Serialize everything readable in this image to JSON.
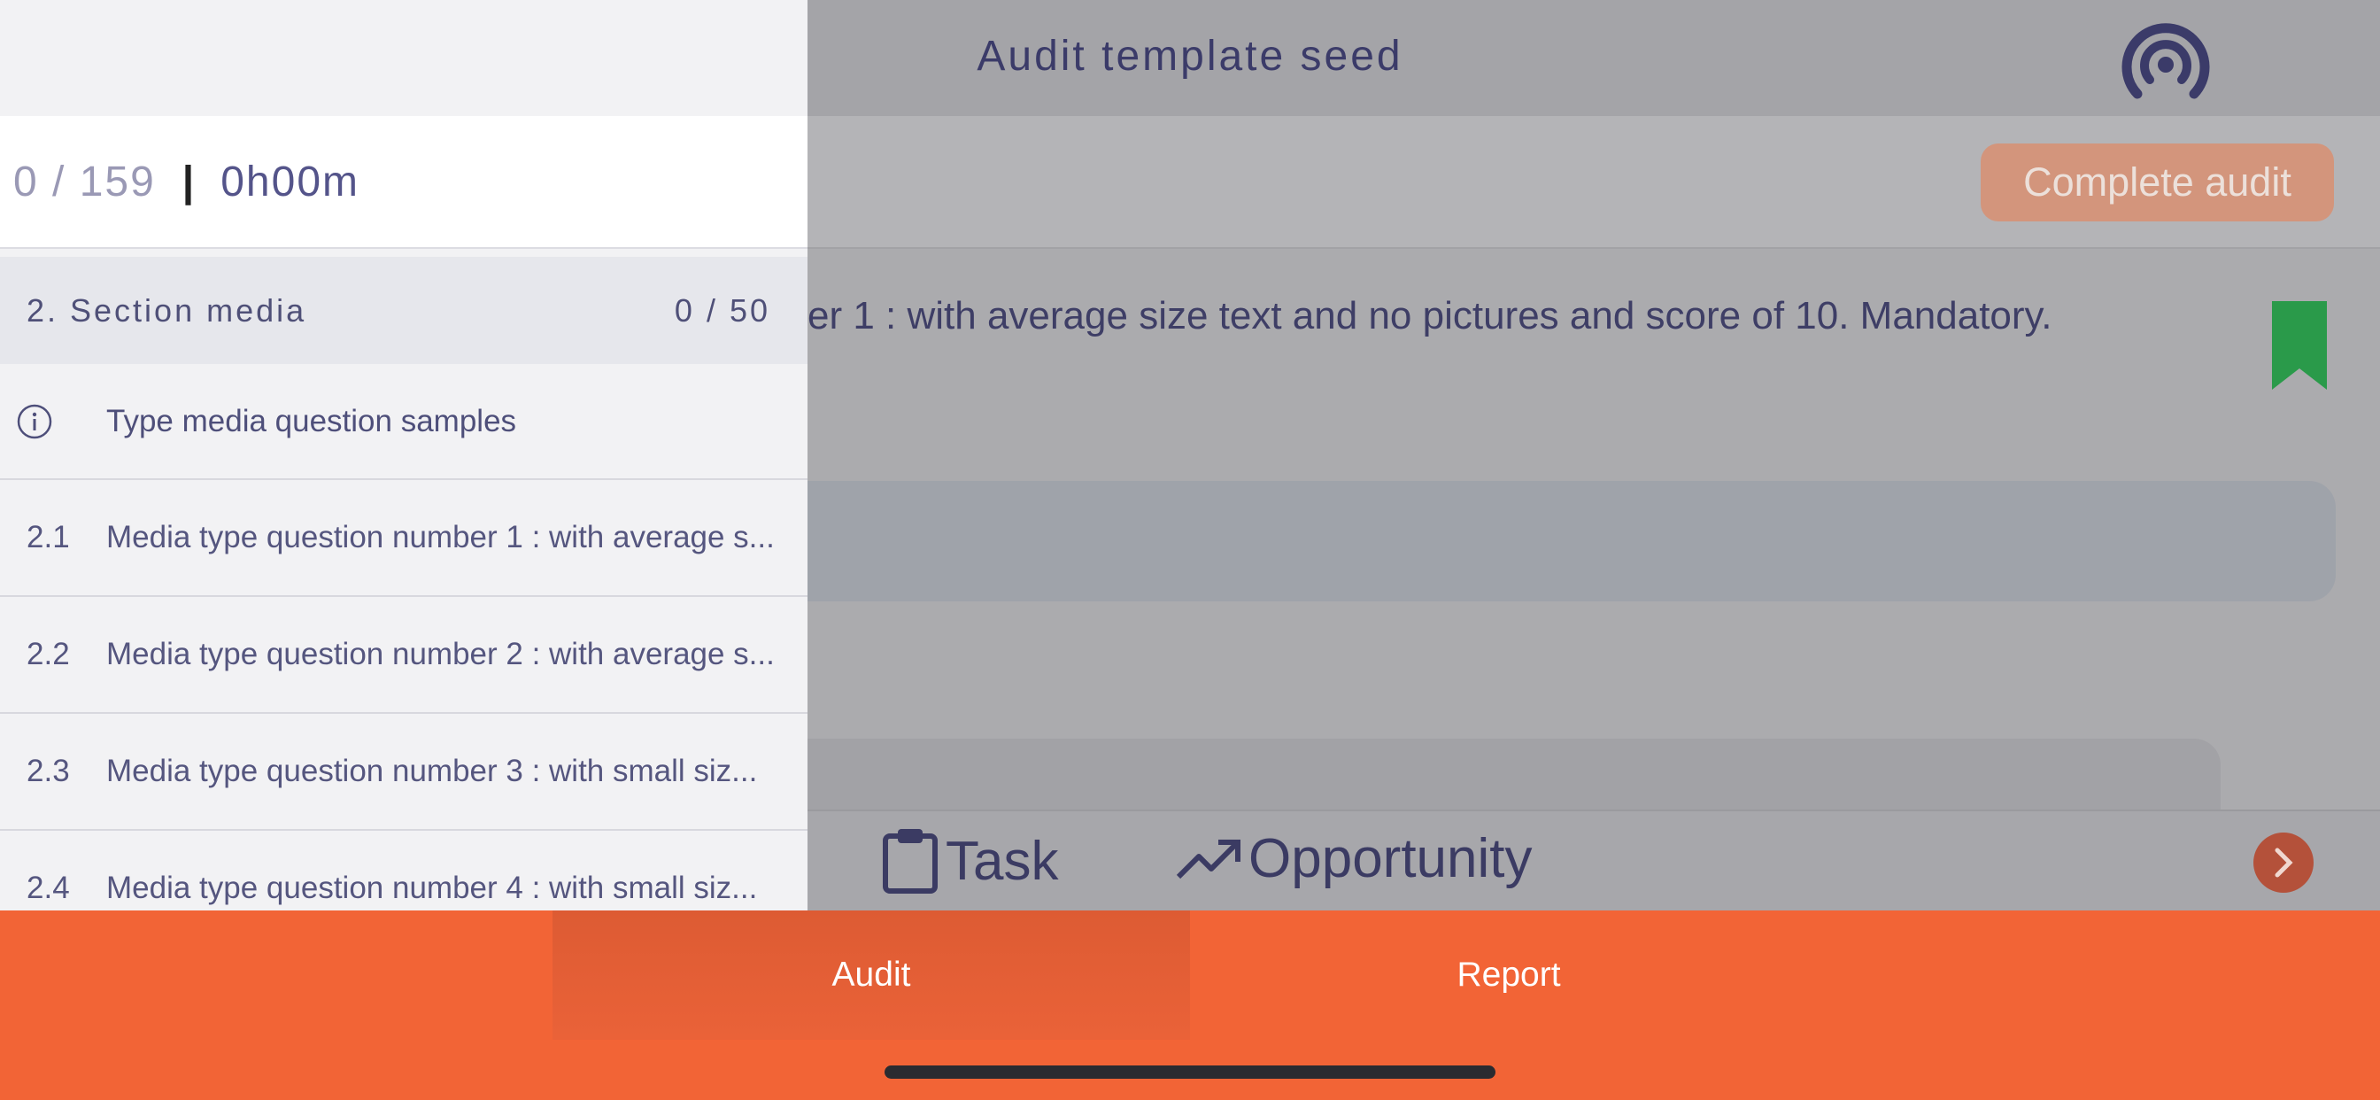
{
  "app": {
    "title": "Audit template seed",
    "broadcast_icon": "broadcast-icon"
  },
  "toolbar": {
    "complete_label": "Complete audit"
  },
  "question": {
    "text": "er 1 : with average size text and no pictures and score of 10. Mandatory."
  },
  "actions": {
    "task_label": "Task",
    "opportunity_label": "Opportunity"
  },
  "drawer": {
    "progress": {
      "count": "0 / 159",
      "separator": "|",
      "time": "0h00m"
    },
    "section": {
      "title": "2. Section media",
      "count": "0 / 50"
    },
    "info": {
      "text": "Type media question samples"
    },
    "questions": [
      {
        "num": "2.1",
        "text": "Media type question number 1 : with average s..."
      },
      {
        "num": "2.2",
        "text": "Media type question number 2 : with average s..."
      },
      {
        "num": "2.3",
        "text": "Media type question number 3 : with small siz..."
      },
      {
        "num": "2.4",
        "text": "Media type question number 4 : with small siz..."
      }
    ]
  },
  "tabs": {
    "audit_label": "Audit",
    "report_label": "Report"
  },
  "colors": {
    "accent": "#f26436",
    "bookmark": "#2a9a4a",
    "navy": "#3b3b69"
  }
}
